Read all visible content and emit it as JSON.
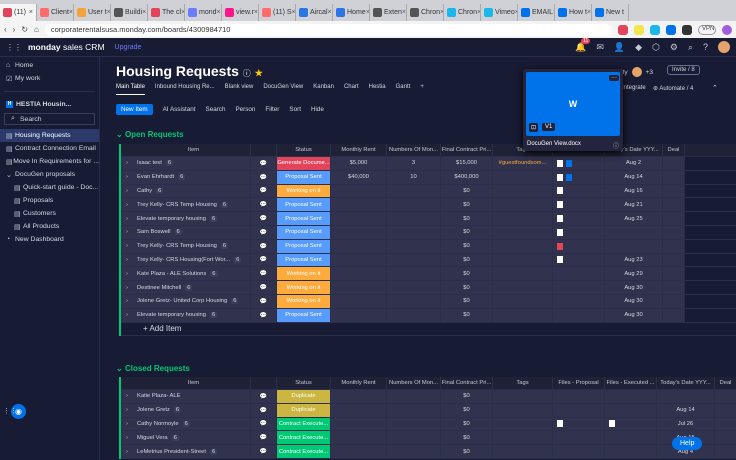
{
  "browser": {
    "tabs": [
      "(11)",
      "Client",
      "User t",
      "Buildi",
      "The cl",
      "mond",
      "view.r",
      "(11) S",
      "Aircal",
      "Home",
      "Exten",
      "Chron",
      "Chron",
      "Vimeo",
      "EMAIL",
      "How t",
      "New t"
    ],
    "url": "corporaterentalsusa.monday.com/boards/4300984710",
    "vpn": "VPN"
  },
  "topnav": {
    "logo": "monday",
    "logo_sub": "sales CRM",
    "upgrade": "Upgrade",
    "notif_count": "11"
  },
  "sidebar": {
    "items": [
      "Home",
      "My work"
    ],
    "workspace": "HESTIA Housin...",
    "search": "Search",
    "boards": [
      "Housing Requests",
      "Contract Connection Email",
      "Move In Requirements for ...",
      "DocuGen proposals",
      "Quick-start guide - Doc...",
      "Proposals",
      "Customers",
      "All Products",
      "New Dashboard"
    ]
  },
  "board": {
    "title": "Housing Requests",
    "views": [
      "Main Table",
      "Inbound Housing Re...",
      "Blank view",
      "DocuGen View",
      "Kanban",
      "Chart",
      "Hestia",
      "Gantt",
      "+"
    ],
    "activity": "Activity",
    "activity_count": "+3",
    "invite": "Invite / 8",
    "integrate": "Integrate",
    "automate": "Automate / 4",
    "toolbar": [
      "New Item",
      "AI Assistant",
      "Search",
      "Person",
      "Filter",
      "Sort",
      "Hide"
    ]
  },
  "popup": {
    "thumb_letter": "W",
    "badge": "V1",
    "filename": "DocuGen View.docx"
  },
  "open_group": {
    "title": "Open Requests",
    "columns": [
      "Item",
      "Status",
      "Monthly Rent",
      "Numbers Of Mon...",
      "Final Contract Pri...",
      "Tags",
      "",
      "Today's Date YYY...",
      "Deal"
    ],
    "rows": [
      {
        "name": "Isaac test",
        "count": "6",
        "status": "Generate Docume...",
        "color": "#e2445c",
        "rent": "$5,000",
        "months": "3",
        "price": "$15,000",
        "tag": "#guestfoundsom...",
        "date": "Aug 2"
      },
      {
        "name": "Evan Ehrhardt",
        "count": "6",
        "status": "Proposal Sent",
        "color": "#579bfc",
        "rent": "$40,000",
        "months": "10",
        "price": "$400,000",
        "tag": "",
        "date": "Aug 14"
      },
      {
        "name": "Cathy",
        "count": "6",
        "status": "Working on it",
        "color": "#fdab3d",
        "rent": "",
        "months": "",
        "price": "$0",
        "tag": "",
        "date": "Aug 16"
      },
      {
        "name": "Trey Kelly- CRS Temp Housing",
        "count": "6",
        "status": "Proposal Sent",
        "color": "#579bfc",
        "rent": "",
        "months": "",
        "price": "$0",
        "tag": "",
        "date": "Aug 21"
      },
      {
        "name": "Elevate temporary housing",
        "count": "6",
        "status": "Proposal Sent",
        "color": "#579bfc",
        "rent": "",
        "months": "",
        "price": "$0",
        "tag": "",
        "date": "Aug 25"
      },
      {
        "name": "Sam Boswell",
        "count": "6",
        "status": "Proposal Sent",
        "color": "#579bfc",
        "rent": "",
        "months": "",
        "price": "$0",
        "tag": "",
        "date": ""
      },
      {
        "name": "Trey Kelly- CRS Temp Housing",
        "count": "6",
        "status": "Proposal Sent",
        "color": "#579bfc",
        "rent": "",
        "months": "",
        "price": "$0",
        "tag": "",
        "date": ""
      },
      {
        "name": "Trey Kelly- CRS Housing(Fort Wor...",
        "count": "6",
        "status": "Proposal Sent",
        "color": "#579bfc",
        "rent": "",
        "months": "",
        "price": "$0",
        "tag": "",
        "date": "Aug 23"
      },
      {
        "name": "Kate Plaza - ALE Solutions",
        "count": "6",
        "status": "Working on it",
        "color": "#fdab3d",
        "rent": "",
        "months": "",
        "price": "$0",
        "tag": "",
        "date": "Aug 29"
      },
      {
        "name": "Destinee Mitchell",
        "count": "6",
        "status": "Working on it",
        "color": "#fdab3d",
        "rent": "",
        "months": "",
        "price": "$0",
        "tag": "",
        "date": "Aug 30"
      },
      {
        "name": "Jolene Gretz- United Corp Housing",
        "count": "6",
        "status": "Working on it",
        "color": "#fdab3d",
        "rent": "",
        "months": "",
        "price": "$0",
        "tag": "",
        "date": "Aug 30"
      },
      {
        "name": "Elevate temporary housing",
        "count": "6",
        "status": "Proposal Sent",
        "color": "#579bfc",
        "rent": "",
        "months": "",
        "price": "$0",
        "tag": "",
        "date": "Aug 30"
      }
    ],
    "add_item": "+ Add Item",
    "summary": {
      "rent": "$45,000",
      "rent_label": "sum",
      "months": "13",
      "months_label": "sum",
      "price": "$415,000",
      "price_label": "sum",
      "tag": "#guestfoundsomeho...",
      "files_more": "+7",
      "date": "Aug 2 - 28"
    }
  },
  "closed_group": {
    "title": "Closed Requests",
    "columns": [
      "Item",
      "Status",
      "Monthly Rent",
      "Numbers Of Mon...",
      "Final Contract Pri...",
      "Tags",
      "Files - Proposal",
      "Files - Executed ...",
      "Today's Date YYY...",
      "Deal"
    ],
    "rows": [
      {
        "name": "Katie Plaza- ALE",
        "count": "",
        "status": "Duplicate",
        "color": "#cab641",
        "price": "$0",
        "date": ""
      },
      {
        "name": "Jolene Gretz",
        "count": "6",
        "status": "Duplicate",
        "color": "#cab641",
        "price": "$0",
        "date": "Aug 14"
      },
      {
        "name": "Cathy Normoyle",
        "count": "6",
        "status": "Contract Execute...",
        "color": "#00c875",
        "price": "$0",
        "date": "Jul 26"
      },
      {
        "name": "Miguel Vera",
        "count": "6",
        "status": "Contract Execute...",
        "color": "#00c875",
        "price": "$0",
        "date": "Aug 15"
      },
      {
        "name": "LeMetrius President-Street",
        "count": "6",
        "status": "Contract Execute...",
        "color": "#00c875",
        "price": "$0",
        "date": "Aug 4"
      }
    ]
  },
  "help": "Help"
}
